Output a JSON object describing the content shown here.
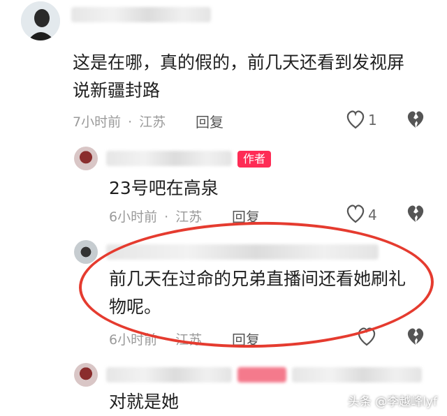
{
  "comments": [
    {
      "text_lines": [
        "这是在哪，真的假的，前几天还看到发视屏",
        "说新疆封路"
      ],
      "time": "7小时前",
      "location": "江苏",
      "reply_label": "回复",
      "likes": "1"
    },
    {
      "author_tag": "作者",
      "text_lines": [
        "23号吧在高泉"
      ],
      "time": "6小时前",
      "location": "江苏",
      "reply_label": "回复",
      "likes": "4"
    },
    {
      "text_lines": [
        "前几天在过命的兄弟直播间还看她刷礼",
        "物呢。"
      ],
      "time": "6小时前",
      "location": "江苏",
      "reply_label": "回复"
    },
    {
      "text_lines": [
        "对就是她"
      ]
    }
  ],
  "separator": "·",
  "watermark": "头条 @李越峰lyf",
  "colors": {
    "author_tag": "#fe2c55",
    "highlight_circle": "#e53b2f"
  },
  "icons": [
    "heart-icon",
    "broken-heart-icon"
  ]
}
